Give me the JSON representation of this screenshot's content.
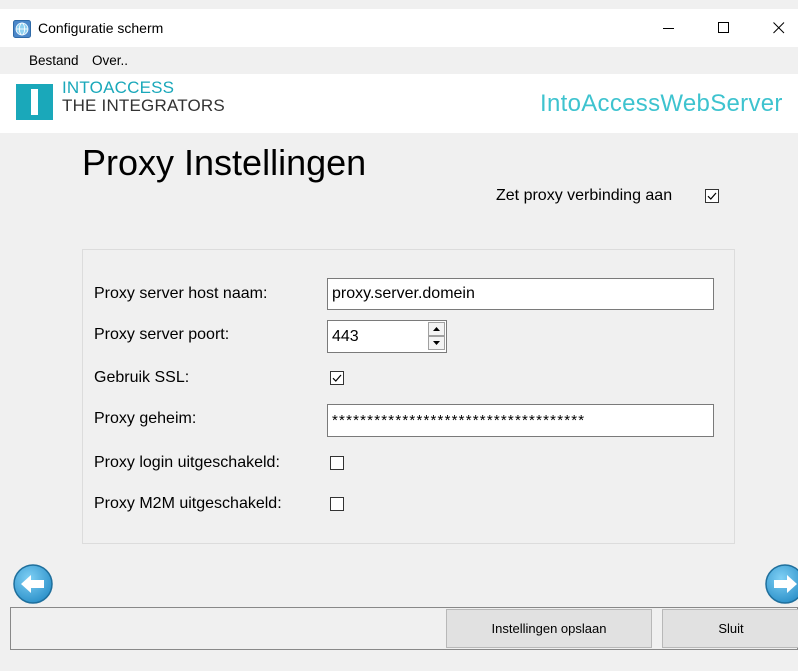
{
  "window": {
    "title": "Configuratie scherm"
  },
  "menu": {
    "items": [
      "Bestand",
      "Over.."
    ]
  },
  "header": {
    "logo_line1": "INTOACCESS",
    "logo_line2": "THE INTEGRATORS",
    "product": "IntoAccessWebServer"
  },
  "page": {
    "title": "Proxy Instellingen",
    "enable_label": "Zet proxy verbinding aan",
    "enable_checked": true
  },
  "form": {
    "host_label": "Proxy server host naam:",
    "host_value": "proxy.server.domein",
    "port_label": "Proxy server poort:",
    "port_value": "443",
    "ssl_label": "Gebruik SSL:",
    "ssl_checked": true,
    "secret_label": "Proxy geheim:",
    "secret_value": "************************************",
    "login_label": "Proxy login uitgeschakeld:",
    "login_checked": false,
    "m2m_label": "Proxy M2M uitgeschakeld:",
    "m2m_checked": false
  },
  "buttons": {
    "save": "Instellingen opslaan",
    "close": "Sluit"
  },
  "colors": {
    "accent": "#1aa8ba",
    "product": "#3ec3cf",
    "nav": "#3ba6d9"
  }
}
